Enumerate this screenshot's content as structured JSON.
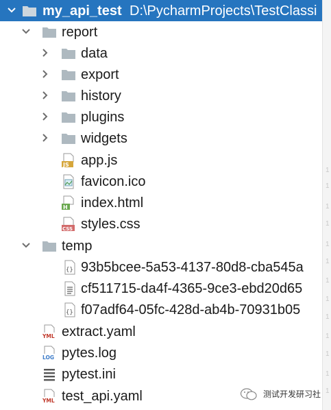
{
  "project": {
    "name": "my_api_test",
    "path": "D:\\PycharmProjects\\TestClassi"
  },
  "tree": {
    "report": {
      "label": "report",
      "children": {
        "data": "data",
        "export": "export",
        "history": "history",
        "plugins": "plugins",
        "widgets": "widgets",
        "app_js": "app.js",
        "favicon": "favicon.ico",
        "index_html": "index.html",
        "styles_css": "styles.css"
      }
    },
    "temp": {
      "label": "temp",
      "children": {
        "file1": "93b5bcee-5a53-4137-80d8-cba545a",
        "file2": "cf511715-da4f-4365-9ce3-ebd20d65",
        "file3": "f07adf64-05fc-428d-ab4b-70931b05"
      }
    },
    "extract_yaml": "extract.yaml",
    "pytes_log": "pytes.log",
    "pytest_ini": "pytest.ini",
    "test_api_yaml": "test_api.yaml"
  },
  "gutter": {
    "line_marker": "1"
  },
  "watermark": {
    "text": "测试开发研习社"
  },
  "colors": {
    "selection": "#2675bf",
    "folder": "#aeb9c0",
    "js_badge": "#d6a63a",
    "html_badge": "#6aa84f",
    "css_badge": "#d26b6b",
    "yaml_badge": "#c0392b",
    "log_badge": "#3d7cc9"
  },
  "icons": {
    "chevron_down": "chevron-down-icon",
    "chevron_right": "chevron-right-icon",
    "folder": "folder-icon",
    "js_file": "js-file-icon",
    "image_file": "image-file-icon",
    "html_file": "html-file-icon",
    "css_file": "css-file-icon",
    "json_file": "json-file-icon",
    "text_file": "text-file-icon",
    "yaml_file": "yaml-file-icon",
    "log_file": "log-file-icon",
    "ini_file": "ini-file-icon"
  }
}
